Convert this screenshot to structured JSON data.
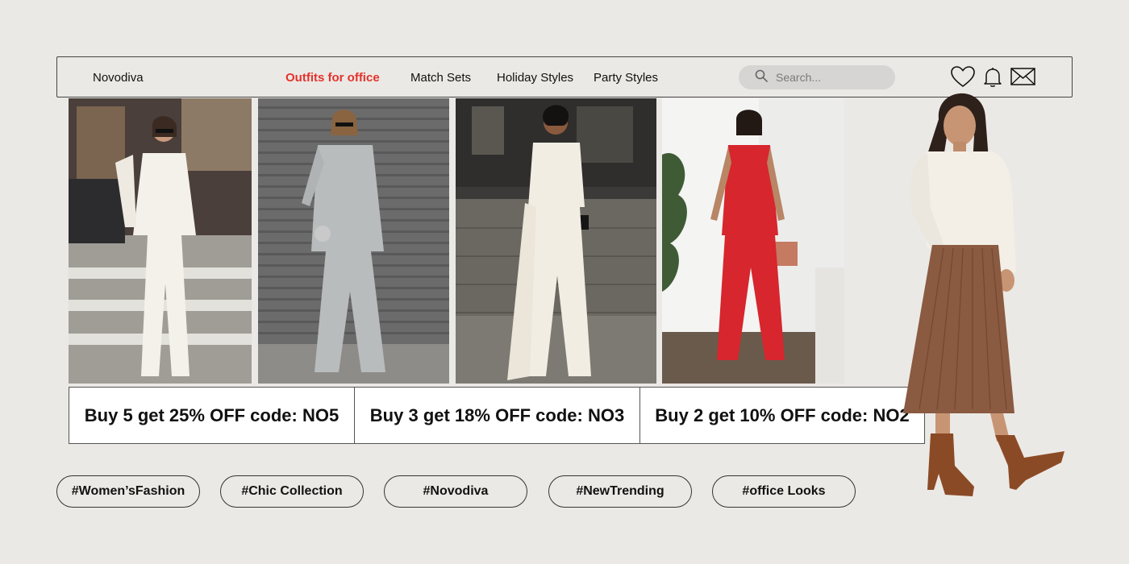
{
  "brand": "Novodiva",
  "nav": {
    "links": [
      {
        "label": "Outfits for office",
        "active": true
      },
      {
        "label": "Match Sets",
        "active": false
      },
      {
        "label": "Holiday Styles",
        "active": false
      },
      {
        "label": "Party Styles",
        "active": false
      }
    ],
    "search_placeholder": "Search...",
    "icons": [
      "heart-icon",
      "bell-icon",
      "mail-icon"
    ]
  },
  "photos": [
    {
      "name": "white-suit-look",
      "outfit_color": "#f4f1ea"
    },
    {
      "name": "grey-suit-look",
      "outfit_color": "#b9bcbd"
    },
    {
      "name": "cream-jumpsuit-look",
      "outfit_color": "#f1ede2"
    },
    {
      "name": "red-jumpsuit-look",
      "outfit_color": "#d7262d"
    }
  ],
  "promos": [
    "Buy 5 get 25% OFF code: NO5",
    "Buy 3 get 18% OFF code: NO3",
    "Buy 2 get 10% OFF code: NO2"
  ],
  "tags": [
    "#Women’sFashion",
    "#Chic Collection",
    "#Novodiva",
    "#NewTrending",
    "#office Looks"
  ],
  "colors": {
    "background": "#ebe9e5",
    "accent": "#e5312c",
    "search_bg": "#d6d5d3"
  }
}
